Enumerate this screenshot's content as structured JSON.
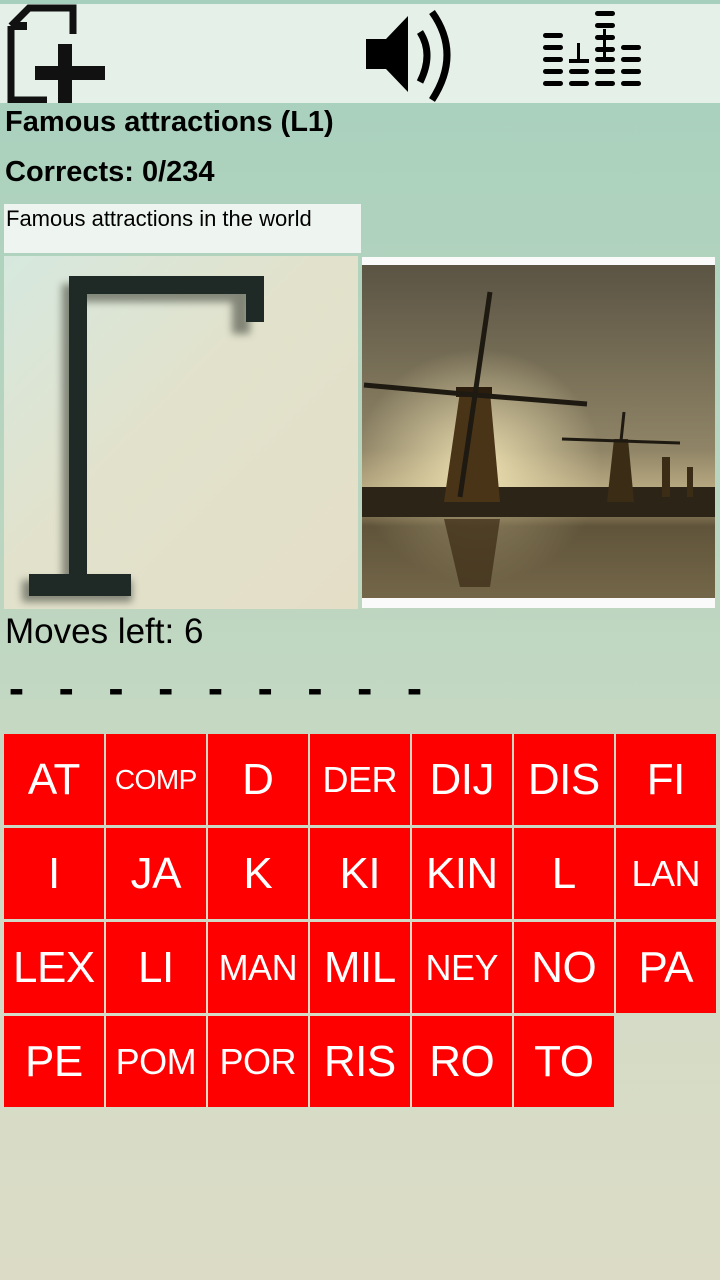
{
  "toolbar": {
    "new_game_icon": "file-plus-icon",
    "sound_icon": "speaker-icon",
    "stats_icon": "equalizer-icon"
  },
  "game": {
    "title": "Famous attractions (L1)",
    "corrects": "Corrects: 0/234",
    "description": "Famous attractions in the world",
    "moves_left": "Moves left: 6",
    "word_pattern": "- -  - -  -  - - - -",
    "hint_image": "Windmills at sunset (Kinderdijk)"
  },
  "tiles": [
    {
      "label": "AT",
      "size": "lg"
    },
    {
      "label": "COMP",
      "size": "sm"
    },
    {
      "label": "D",
      "size": "lg"
    },
    {
      "label": "DER",
      "size": "md"
    },
    {
      "label": "DIJ",
      "size": "lg"
    },
    {
      "label": "DIS",
      "size": "lg"
    },
    {
      "label": "FI",
      "size": "lg"
    },
    {
      "label": "I",
      "size": "lg"
    },
    {
      "label": "JA",
      "size": "lg"
    },
    {
      "label": "K",
      "size": "lg"
    },
    {
      "label": "KI",
      "size": "lg"
    },
    {
      "label": "KIN",
      "size": "lg"
    },
    {
      "label": "L",
      "size": "lg"
    },
    {
      "label": "LAN",
      "size": "md"
    },
    {
      "label": "LEX",
      "size": "lg"
    },
    {
      "label": "LI",
      "size": "lg"
    },
    {
      "label": "MAN",
      "size": "md"
    },
    {
      "label": "MIL",
      "size": "lg"
    },
    {
      "label": "NEY",
      "size": "md"
    },
    {
      "label": "NO",
      "size": "lg"
    },
    {
      "label": "PA",
      "size": "lg"
    },
    {
      "label": "PE",
      "size": "lg"
    },
    {
      "label": "POM",
      "size": "md"
    },
    {
      "label": "POR",
      "size": "md"
    },
    {
      "label": "RIS",
      "size": "lg"
    },
    {
      "label": "RO",
      "size": "lg"
    },
    {
      "label": "TO",
      "size": "lg"
    }
  ],
  "colors": {
    "tile_bg": "#fe0000",
    "tile_text": "#ffffff",
    "toolbar_bg": "#e4f0e8"
  }
}
